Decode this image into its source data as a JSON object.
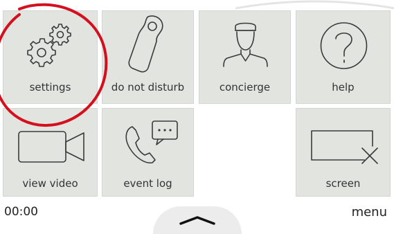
{
  "tiles": {
    "settings": "settings",
    "do_not_disturb": "do not disturb",
    "concierge": "concierge",
    "help": "help",
    "view_video": "view video",
    "event_log": "event log",
    "screen": "screen"
  },
  "status_bar": {
    "time": "00:00",
    "menu_label": "menu"
  },
  "icons": {
    "settings": "gears-icon",
    "do_not_disturb": "door-hanger-icon",
    "concierge": "concierge-person-icon",
    "help": "question-mark-icon",
    "view_video": "video-camera-icon",
    "event_log": "phone-message-icon",
    "screen": "screen-off-icon",
    "drawer": "chevron-up-icon"
  },
  "colors": {
    "tile_background": "#e2e4df",
    "icon_stroke": "#3a3a3a",
    "highlight_ring": "#d4101e"
  }
}
